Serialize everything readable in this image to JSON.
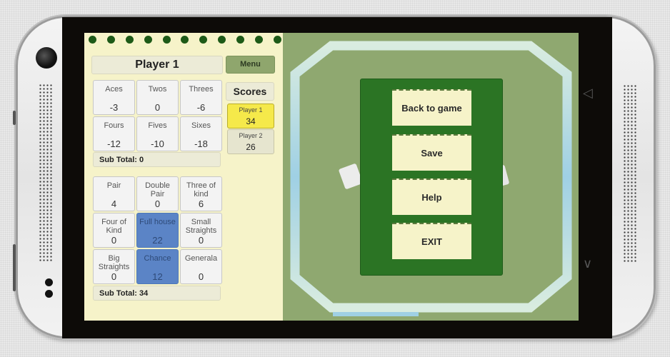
{
  "device": {
    "nav_icons": [
      "back-icon",
      "recent-apps-icon"
    ]
  },
  "scorecard": {
    "player_title": "Player 1",
    "menu_label": "Menu",
    "scores_label": "Scores",
    "player_scores": [
      {
        "name": "Player 1",
        "score": "34",
        "active": true,
        "color": "#f5e94a"
      },
      {
        "name": "Player 2",
        "score": "26",
        "active": false,
        "color": "#e6e5cf"
      }
    ],
    "upper": [
      {
        "label": "Aces",
        "value": "-3"
      },
      {
        "label": "Twos",
        "value": "0"
      },
      {
        "label": "Threes",
        "value": "-6"
      },
      {
        "label": "Fours",
        "value": "-12"
      },
      {
        "label": "Fives",
        "value": "-10"
      },
      {
        "label": "Sixes",
        "value": "-18"
      }
    ],
    "upper_subtotal": "Sub Total: 0",
    "lower": [
      {
        "label": "Pair",
        "value": "4",
        "selected": false
      },
      {
        "label": "Double Pair",
        "value": "0",
        "selected": false
      },
      {
        "label": "Three of kind",
        "value": "6",
        "selected": false
      },
      {
        "label": "Four of Kind",
        "value": "0",
        "selected": false
      },
      {
        "label": "Full house",
        "value": "22",
        "selected": true
      },
      {
        "label": "Small Straights",
        "value": "0",
        "selected": false
      },
      {
        "label": "Big Straights",
        "value": "0",
        "selected": false
      },
      {
        "label": "Chance",
        "value": "12",
        "selected": true
      },
      {
        "label": "Generala",
        "value": "0",
        "selected": false
      }
    ],
    "lower_subtotal": "Sub Total: 34"
  },
  "game_menu": {
    "buttons": [
      "Back to game",
      "Save",
      "Help",
      "EXIT"
    ]
  },
  "colors": {
    "pad": "#f6f3c9",
    "table_felt": "#8fa870",
    "menu_panel": "#2b7424",
    "selected_cell": "#5b84c6",
    "active_player": "#f5e94a"
  }
}
